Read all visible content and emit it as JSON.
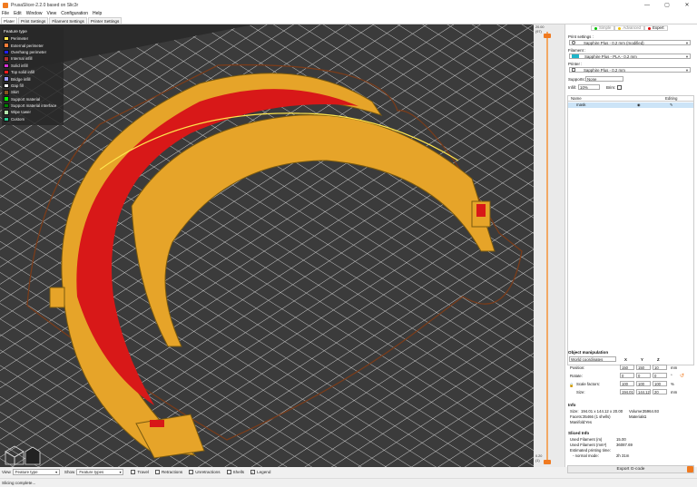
{
  "window": {
    "title": "PrusaSlicer-2.2.0 based on Slic3r",
    "controls": [
      "—",
      "▢",
      "✕"
    ]
  },
  "menu": [
    "File",
    "Edit",
    "Window",
    "View",
    "Configuration",
    "Help"
  ],
  "tabs": [
    "Plater",
    "Print Settings",
    "Filament Settings",
    "Printer Settings"
  ],
  "legend": {
    "title": "Feature type",
    "items": [
      {
        "label": "Perimeter",
        "color": "#ffe64d"
      },
      {
        "label": "External perimeter",
        "color": "#ff7d38"
      },
      {
        "label": "Overhang perimeter",
        "color": "#1f1fff"
      },
      {
        "label": "Internal infill",
        "color": "#b03029"
      },
      {
        "label": "Solid infill",
        "color": "#d732d7"
      },
      {
        "label": "Top solid infill",
        "color": "#ff1a1a"
      },
      {
        "label": "Bridge infill",
        "color": "#9999ff"
      },
      {
        "label": "Gap fill",
        "color": "#ffffff"
      },
      {
        "label": "Skirt",
        "color": "#845321"
      },
      {
        "label": "Support material",
        "color": "#00ff00"
      },
      {
        "label": "Support material interface",
        "color": "#008000"
      },
      {
        "label": "Wipe tower",
        "color": "#b3e3ab"
      },
      {
        "label": "Custom",
        "color": "#28cc94"
      }
    ]
  },
  "slider": {
    "top_value": "20.00",
    "top_layer": "(97)",
    "bottom_value": "0.20",
    "bottom_layer": "(1)"
  },
  "modes": [
    {
      "label": "Simple",
      "color": "#00c000",
      "active": false
    },
    {
      "label": "Advanced",
      "color": "#f0c000",
      "active": false
    },
    {
      "label": "Expert",
      "color": "#e00000",
      "active": true
    }
  ],
  "settings": {
    "print_label": "Print settings :",
    "print_value": "Sapphire Plus - 0.2 mm (modified)",
    "filament_label": "Filament :",
    "filament_value": "Sapphire Plus - PLA - 0.2 mm",
    "filament_color": "#1fb5c9",
    "printer_label": "Printer :",
    "printer_value": "Sapphire Plus - 0.2 mm",
    "supports_label": "Supports:",
    "supports_value": "None",
    "infill_label": "Infill:",
    "infill_value": "10%",
    "brim_label": "Brim:"
  },
  "objects": {
    "col_name": "Name",
    "col_editing": "Editing",
    "rows": [
      {
        "name": "mask"
      }
    ]
  },
  "manipulation": {
    "title": "Object manipulation",
    "coord_system": "World coordinates",
    "axes": [
      "X",
      "Y",
      "Z"
    ],
    "position_label": "Position:",
    "position": [
      "150",
      "150",
      "10"
    ],
    "position_unit": "mm",
    "rotate_label": "Rotate:",
    "rotate": [
      "0",
      "0",
      "0"
    ],
    "rotate_unit": "°",
    "scale_label": "Scale factors:",
    "scale": [
      "100",
      "100",
      "100"
    ],
    "scale_unit": "%",
    "size_label": "Size:",
    "size": [
      "194.01",
      "144.12",
      "20"
    ],
    "size_unit": "mm"
  },
  "info": {
    "title": "Info",
    "size_label": "Size:",
    "size_value": "194.01 x 144.12 x 20.00",
    "volume_label": "Volume:",
    "volume_value": "35964.93",
    "facets_label": "Facets:",
    "facets_value": "35466 (1 shells)",
    "materials_label": "Materials:",
    "materials_value": "1",
    "manifold_label": "Manifold:",
    "manifold_value": "Yes"
  },
  "sliced": {
    "title": "Sliced Info",
    "filament_m_label": "Used Filament (m)",
    "filament_m_value": "15.00",
    "filament_mm3_label": "Used Filament (mm³)",
    "filament_mm3_value": "36087.69",
    "time_label": "Estimated printing time:",
    "mode_label": "- normal mode:",
    "mode_value": "2h 31m"
  },
  "export_label": "Export G-code",
  "bottom": {
    "view_label": "View",
    "view_value": "Feature type",
    "show_label": "Show",
    "show_value": "Feature types",
    "checks": [
      {
        "label": "Travel",
        "checked": false
      },
      {
        "label": "Retractions",
        "checked": false
      },
      {
        "label": "Unretractions",
        "checked": false
      },
      {
        "label": "Shells",
        "checked": false
      },
      {
        "label": "Legend",
        "checked": true
      }
    ]
  },
  "status": "Slicing complete..."
}
